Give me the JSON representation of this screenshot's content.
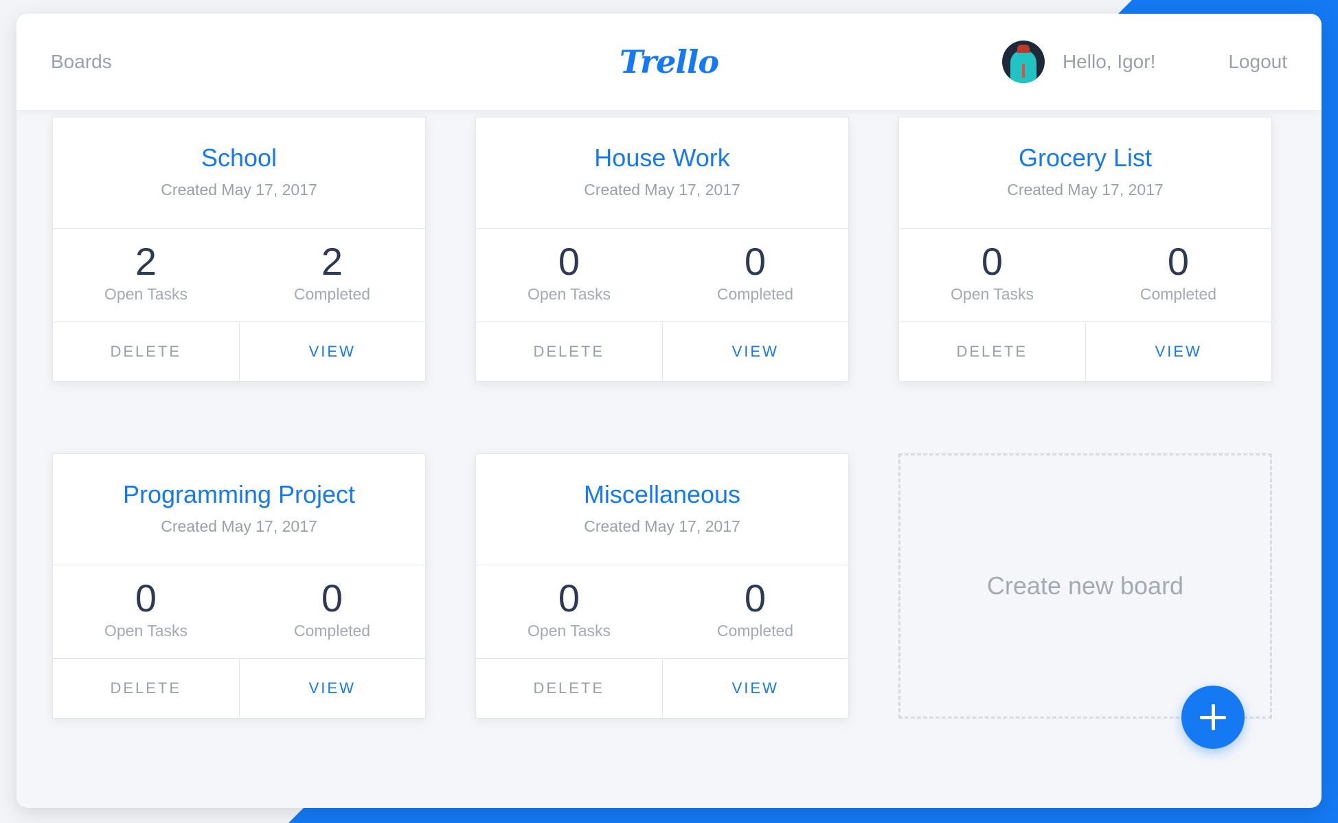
{
  "header": {
    "nav_boards": "Boards",
    "logo": "Trello",
    "greeting": "Hello, Igor!",
    "logout": "Logout"
  },
  "boards": [
    {
      "title": "School",
      "created": "Created May 17, 2017",
      "open_tasks": "2",
      "open_label": "Open Tasks",
      "completed": "2",
      "completed_label": "Completed",
      "delete_label": "DELETE",
      "view_label": "VIEW"
    },
    {
      "title": "House Work",
      "created": "Created May 17, 2017",
      "open_tasks": "0",
      "open_label": "Open Tasks",
      "completed": "0",
      "completed_label": "Completed",
      "delete_label": "DELETE",
      "view_label": "VIEW"
    },
    {
      "title": "Grocery List",
      "created": "Created May 17, 2017",
      "open_tasks": "0",
      "open_label": "Open Tasks",
      "completed": "0",
      "completed_label": "Completed",
      "delete_label": "DELETE",
      "view_label": "VIEW"
    },
    {
      "title": "Programming Project",
      "created": "Created May 17, 2017",
      "open_tasks": "0",
      "open_label": "Open Tasks",
      "completed": "0",
      "completed_label": "Completed",
      "delete_label": "DELETE",
      "view_label": "VIEW"
    },
    {
      "title": "Miscellaneous",
      "created": "Created May 17, 2017",
      "open_tasks": "0",
      "open_label": "Open Tasks",
      "completed": "0",
      "completed_label": "Completed",
      "delete_label": "DELETE",
      "view_label": "VIEW"
    }
  ],
  "new_board": {
    "label": "Create new board",
    "fab_icon": "plus-icon"
  },
  "colors": {
    "accent": "#1479f2",
    "muted_text": "#9aa0a6",
    "number_text": "#2d3a55"
  }
}
